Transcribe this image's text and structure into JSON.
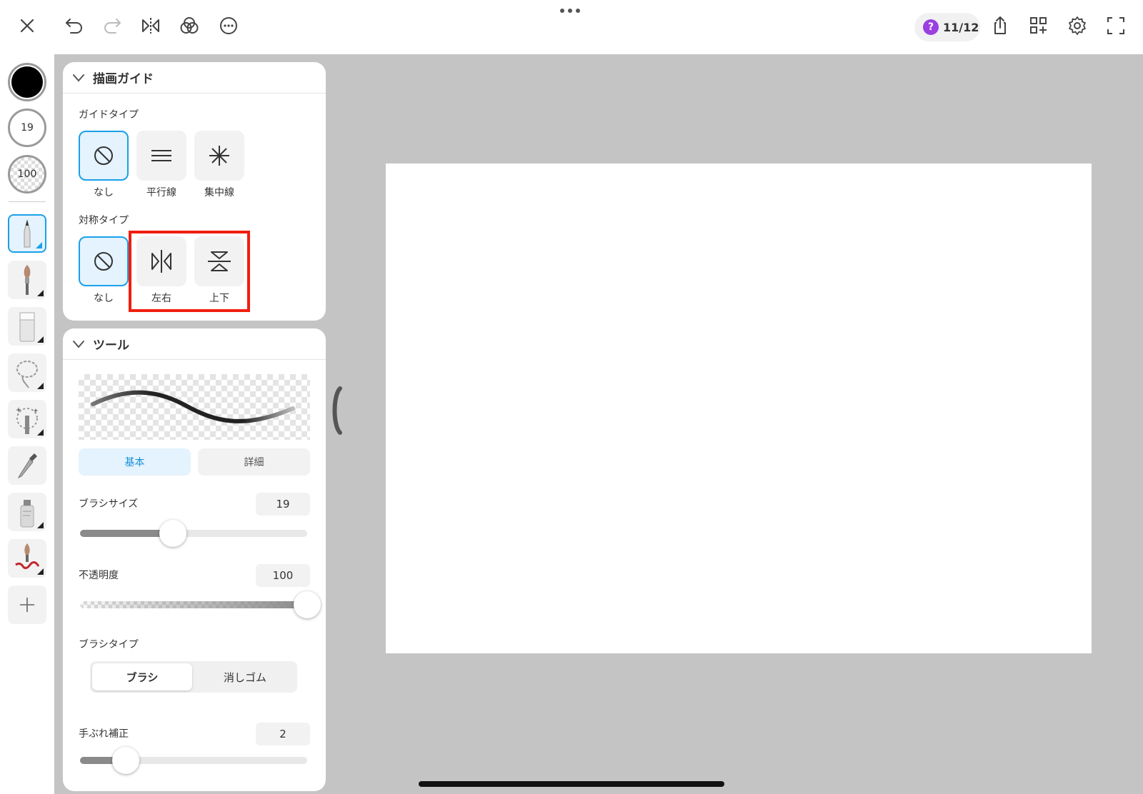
{
  "top_bar": {
    "page_indicator": "11/12",
    "help_symbol": "?"
  },
  "left_bar": {
    "brush_size": "19",
    "opacity": "100"
  },
  "guide_panel": {
    "title": "描画ガイド",
    "guide_type_label": "ガイドタイプ",
    "guide_options": [
      "なし",
      "平行線",
      "集中線"
    ],
    "symmetry_type_label": "対称タイプ",
    "symmetry_options": [
      "なし",
      "左右",
      "上下"
    ]
  },
  "tool_panel": {
    "title": "ツール",
    "tabs": [
      "基本",
      "詳細"
    ],
    "brush_size": {
      "label": "ブラシサイズ",
      "value": "19",
      "fraction": 0.41
    },
    "opacity": {
      "label": "不透明度",
      "value": "100",
      "fraction": 1.0
    },
    "brush_type": {
      "label": "ブラシタイプ",
      "options": [
        "ブラシ",
        "消しゴム"
      ],
      "selected": "ブラシ"
    },
    "stabilizer": {
      "label": "手ぶれ補正",
      "value": "2",
      "fraction": 0.2
    }
  },
  "colors": {
    "accent": "#1aa0e8",
    "current_color": "#000000",
    "highlight": "#f01e10",
    "help_badge": "#9b3fe0"
  }
}
